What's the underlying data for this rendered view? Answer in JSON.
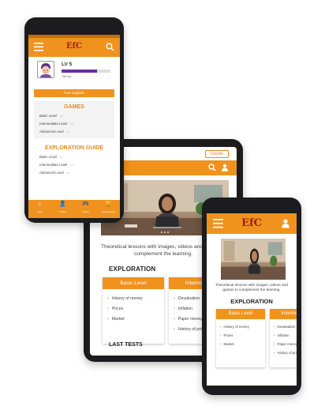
{
  "colors": {
    "brand_orange": "#f0921e",
    "logo_red": "#9a1f1f",
    "progress_purple": "#6b2fa0"
  },
  "tablet": {
    "donate_label": "Donate",
    "icons": [
      "search-icon",
      "user-icon"
    ],
    "description": "Theoretical lessons with images, videos and games to complement the learning.",
    "section_title": "EXPLORATION",
    "cards": [
      {
        "title": "Basic Level",
        "items": [
          "History of money",
          "Prices",
          "Market"
        ]
      },
      {
        "title": "Intermediate",
        "items": [
          "Devaluation",
          "Inflation",
          "Paper money",
          "History of price"
        ]
      }
    ],
    "last_tests": "LAST TESTS"
  },
  "phone_left": {
    "logo": "EfC",
    "profile": {
      "level": "LV 5",
      "xp": "785 exp",
      "progress": 0.72
    },
    "explore_button": "Free Explore",
    "games": {
      "title": "GAMES",
      "levels": [
        "Basic Level",
        "Intermediate Level",
        "Advanced Level"
      ]
    },
    "guide": {
      "title": "EXPLORATION GUIDE",
      "levels": [
        "Basic Level",
        "Intermediate Level",
        "Advanced Level"
      ]
    },
    "nav": [
      {
        "label": "Home",
        "icon": "home-icon"
      },
      {
        "label": "Profile",
        "icon": "profile-icon"
      },
      {
        "label": "Games",
        "icon": "gamepad-icon"
      },
      {
        "label": "Achievements",
        "icon": "trophy-icon"
      }
    ]
  },
  "phone_right": {
    "logo": "EfC",
    "description": "Theoretical lessons with images, videos and games to complement the learning.",
    "section_title": "EXPLORATION",
    "cards": [
      {
        "title": "Basic Level",
        "items": [
          "History of money",
          "Prices",
          "Market"
        ]
      },
      {
        "title": "Intermediate",
        "items": [
          "Devaluation",
          "Inflation",
          "Paper money",
          "History of price"
        ]
      }
    ]
  }
}
